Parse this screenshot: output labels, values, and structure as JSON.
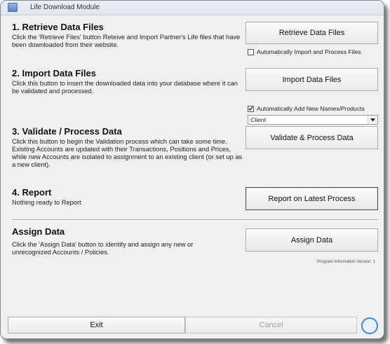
{
  "window": {
    "title": "Life Download Module"
  },
  "sections": {
    "retrieve": {
      "title": "1. Retrieve Data Files",
      "description": "Click the 'Retrieve Files' button Reteive and Import Partner's Life files that have been downloaded from their website.",
      "button_label": "Retrieve Data Files",
      "auto_checkbox": {
        "label": "Automatically Import and Process Files",
        "checked": false
      }
    },
    "import": {
      "title": "2. Import Data Files",
      "description": "Click this button to insert the downloaded data into your database where it can be validated and processed.",
      "button_label": "Import Data Files",
      "auto_checkbox": {
        "label": "Automatically Add New Names/Products",
        "checked": true
      },
      "dropdown": {
        "selected": "Client"
      }
    },
    "validate": {
      "title": "3. Validate / Process Data",
      "description": "Click this button to begin the Validation process which can take some time. Existing Accounts are updated with their Transactions, Positions and Prices, while new Accounts are isolated to assignment to an existing client (or set up as a new client).",
      "button_label": "Validate & Process Data"
    },
    "report": {
      "title": "4. Report",
      "description": "Nothing ready to Report",
      "button_label": "Report on Latest Process"
    },
    "assign": {
      "title": "Assign Data",
      "description": "Click the 'Assign Data' button to identify and assign any new or unrecognized Accounts / Policies.",
      "button_label": "Assign Data"
    }
  },
  "footer": {
    "version_text": "Program Information Version: 1",
    "exit_label": "Exit",
    "cancel_label": "Cancel"
  },
  "icons": {
    "window": "window-icon",
    "help": "help-icon"
  },
  "colors": {
    "background": "#f0f0f0",
    "disabled_text": "#a4a4a4"
  }
}
